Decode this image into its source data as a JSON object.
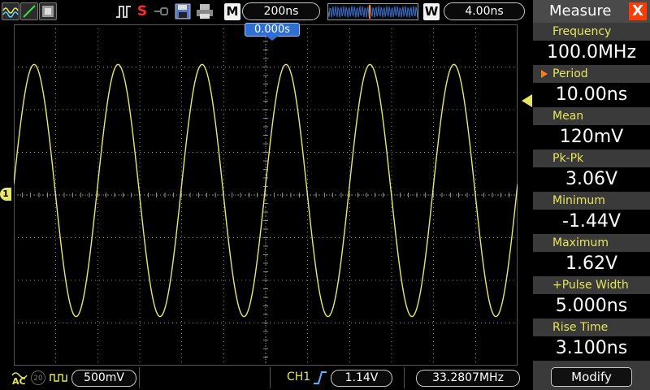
{
  "toolbar": {
    "timebase": "200ns",
    "trigger_delay": "4.00ns",
    "mode_m_label": "M",
    "mode_w_label": "W",
    "stop_label": "S",
    "icons": [
      "waveform-icon",
      "slope-icon",
      "memory-icon",
      "pulse-icon",
      "link-icon",
      "save-icon",
      "print-icon"
    ]
  },
  "screen": {
    "trigger_position_label": "0.000s",
    "ch1_marker_label": "1",
    "trace_color": "#e8e870",
    "grid_color": "#8a8a8a",
    "grid": {
      "h_divisions": 12,
      "v_divisions": 8
    }
  },
  "waveform": {
    "type": "sine",
    "frequency_label": "100.0MHz",
    "cycles_on_screen": 6,
    "peak_div": 3.06,
    "trough_div": -2.85
  },
  "status": {
    "coupling": "AC",
    "bw_limit": "20",
    "volts_per_div": "500mV",
    "channel": "CH1",
    "trigger_level": "1.14V",
    "trigger_frequency": "33.2807MHz"
  },
  "measure": {
    "title": "Measure",
    "close_symbol": "X",
    "items": [
      {
        "label": "Frequency",
        "value": "100.0MHz",
        "selected": false
      },
      {
        "label": "Period",
        "value": "10.00ns",
        "selected": true
      },
      {
        "label": "Mean",
        "value": "120mV",
        "selected": false
      },
      {
        "label": "Pk-Pk",
        "value": "3.06V",
        "selected": false
      },
      {
        "label": "Minimum",
        "value": "-1.44V",
        "selected": false
      },
      {
        "label": "Maximum",
        "value": "1.62V",
        "selected": false
      },
      {
        "label": "+Pulse Width",
        "value": "5.000ns",
        "selected": false
      },
      {
        "label": "Rise Time",
        "value": "3.100ns",
        "selected": false
      }
    ],
    "modify_label": "Modify"
  },
  "colors": {
    "accent_yellow": "#e6e65a",
    "close_red": "#ff3b00",
    "selector_orange": "#ff7a1a",
    "trigger_blue": "#2f6fd1"
  }
}
